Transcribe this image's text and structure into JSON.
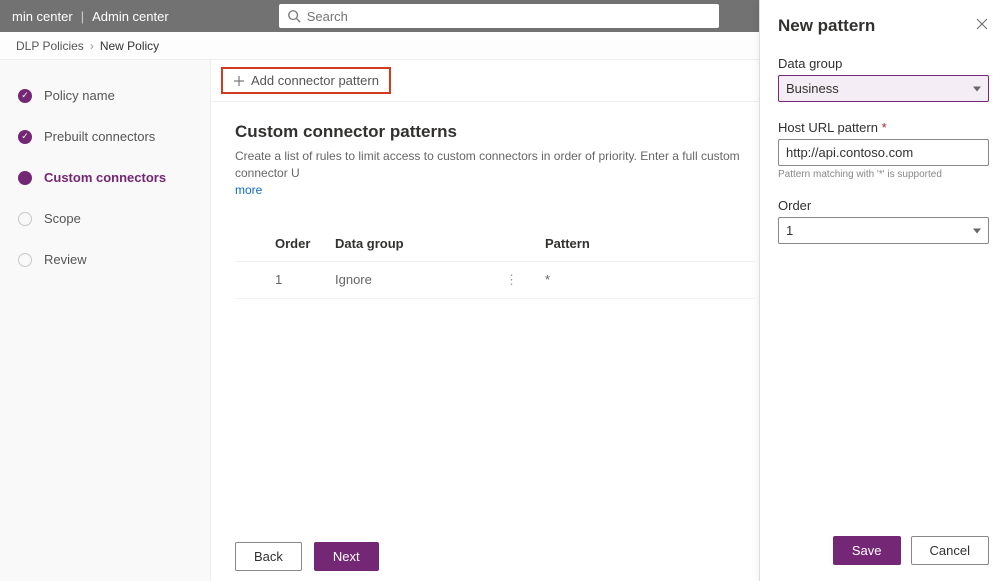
{
  "topbar": {
    "left1": "min center",
    "left2": "Admin center",
    "search_placeholder": "Search"
  },
  "breadcrumb": {
    "parent": "DLP Policies",
    "current": "New Policy"
  },
  "steps": [
    {
      "label": "Policy name",
      "state": "done"
    },
    {
      "label": "Prebuilt connectors",
      "state": "done"
    },
    {
      "label": "Custom connectors",
      "state": "active"
    },
    {
      "label": "Scope",
      "state": "pending"
    },
    {
      "label": "Review",
      "state": "pending"
    }
  ],
  "cmd": {
    "add_label": "Add connector pattern"
  },
  "section": {
    "title": "Custom connector patterns",
    "desc": "Create a list of rules to limit access to custom connectors in order of priority. Enter a full custom connector U",
    "more": "more"
  },
  "table": {
    "headers": {
      "order": "Order",
      "group": "Data group",
      "pattern": "Pattern"
    },
    "rows": [
      {
        "order": "1",
        "group": "Ignore",
        "pattern": "*"
      }
    ]
  },
  "footer": {
    "back": "Back",
    "next": "Next"
  },
  "panel": {
    "title": "New pattern",
    "data_group_label": "Data group",
    "data_group_value": "Business",
    "host_label": "Host URL pattern",
    "host_value": "http://api.contoso.com",
    "host_hint": "Pattern matching with '*' is supported",
    "order_label": "Order",
    "order_value": "1",
    "save": "Save",
    "cancel": "Cancel"
  }
}
